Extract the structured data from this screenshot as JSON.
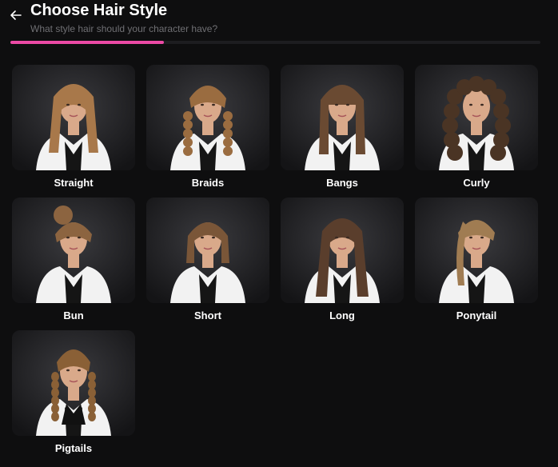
{
  "header": {
    "title": "Choose Hair Style",
    "subtitle": "What style hair should your character have?",
    "progress_percent": 29
  },
  "styles": [
    {
      "label": "Straight",
      "hair_color": "#a8784a",
      "hair_type": "straight"
    },
    {
      "label": "Braids",
      "hair_color": "#9a6c40",
      "hair_type": "braids"
    },
    {
      "label": "Bangs",
      "hair_color": "#6a4a32",
      "hair_type": "bangs"
    },
    {
      "label": "Curly",
      "hair_color": "#4a3424",
      "hair_type": "curly"
    },
    {
      "label": "Bun",
      "hair_color": "#8c6440",
      "hair_type": "bun"
    },
    {
      "label": "Short",
      "hair_color": "#7a5638",
      "hair_type": "short"
    },
    {
      "label": "Long",
      "hair_color": "#5a3e2c",
      "hair_type": "long"
    },
    {
      "label": "Ponytail",
      "hair_color": "#a07c52",
      "hair_type": "ponytail"
    },
    {
      "label": "Pigtails",
      "hair_color": "#8a6036",
      "hair_type": "pigtails"
    }
  ],
  "colors": {
    "accent": "#ec4aa5",
    "background": "#0e0e0f",
    "subtitle": "#6f6f73"
  }
}
